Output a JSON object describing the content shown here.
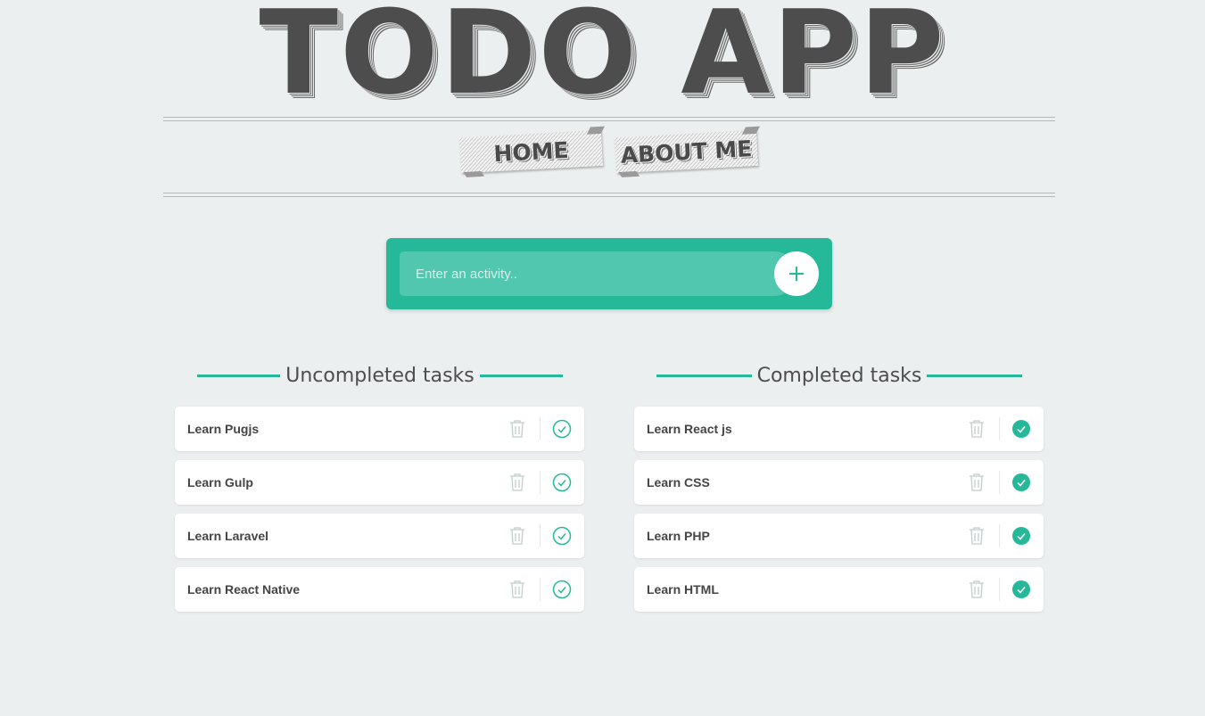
{
  "app": {
    "title": "TODO APP"
  },
  "nav": {
    "home": "HOME",
    "about": "ABOUT ME"
  },
  "add": {
    "placeholder": "Enter an activity.."
  },
  "uncompleted": {
    "heading": "Uncompleted tasks",
    "items": [
      {
        "label": "Learn Pugjs"
      },
      {
        "label": "Learn Gulp"
      },
      {
        "label": "Learn Laravel"
      },
      {
        "label": "Learn React Native"
      }
    ]
  },
  "completed": {
    "heading": "Completed tasks",
    "items": [
      {
        "label": "Learn React js"
      },
      {
        "label": "Learn CSS"
      },
      {
        "label": "Learn PHP"
      },
      {
        "label": "Learn HTML"
      }
    ]
  },
  "colors": {
    "accent": "#25b99a",
    "background": "#ecefef",
    "trash": "#c0cecb"
  },
  "icons": {
    "trash": "trash-icon",
    "check": "check-circle-icon",
    "add": "plus-icon"
  }
}
